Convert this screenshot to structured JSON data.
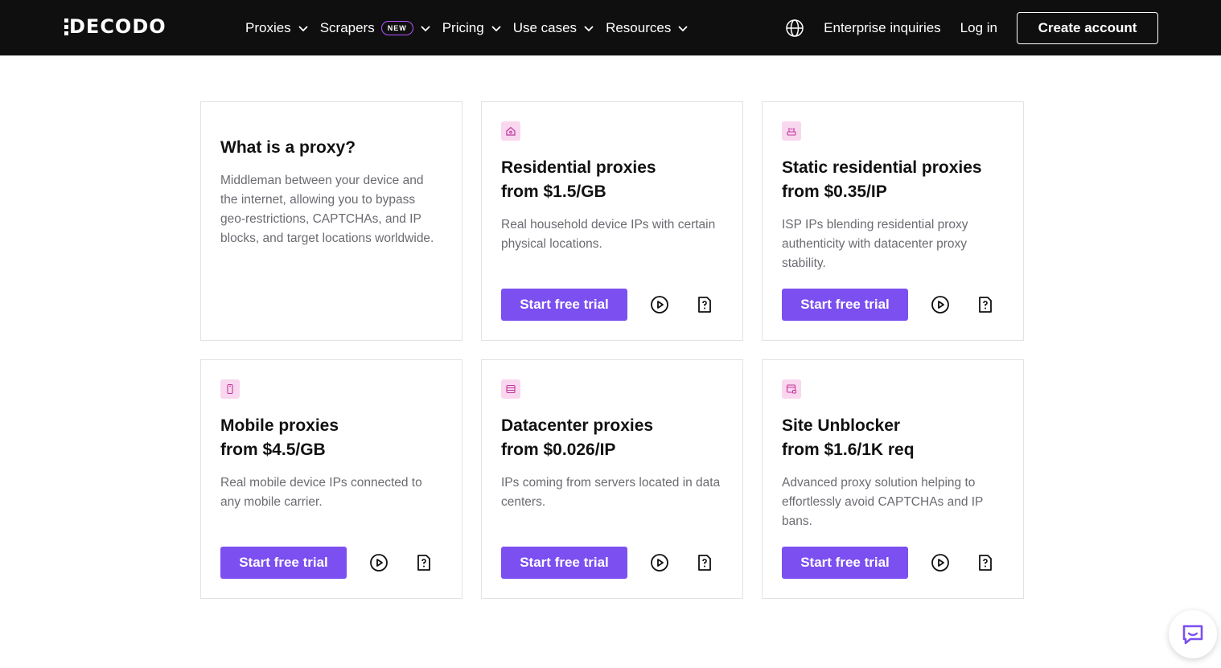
{
  "brand": {
    "logo_text": "DECODO"
  },
  "nav": {
    "items": [
      {
        "label": "Proxies",
        "badge": ""
      },
      {
        "label": "Scrapers",
        "badge": "NEW"
      },
      {
        "label": "Pricing",
        "badge": ""
      },
      {
        "label": "Use cases",
        "badge": ""
      },
      {
        "label": "Resources",
        "badge": ""
      }
    ],
    "enterprise": "Enterprise inquiries",
    "login": "Log in",
    "create_account": "Create account"
  },
  "intro_card": {
    "title": "What is a proxy?",
    "description": "Middleman between your device and the internet, allowing you to bypass geo-restrictions, CAPTCHAs, and IP blocks, and target locations worldwide."
  },
  "products": [
    {
      "icon": "home-icon",
      "title": "Residential proxies",
      "price": "from $1.5/GB",
      "description": "Real household device IPs with certain physical locations.",
      "cta": "Start free trial"
    },
    {
      "icon": "router-icon",
      "title": "Static residential proxies",
      "price": "from $0.35/IP",
      "description": "ISP IPs blending residential proxy authenticity with datacenter proxy stability.",
      "cta": "Start free trial"
    },
    {
      "icon": "mobile-icon",
      "title": "Mobile proxies",
      "price": "from $4.5/GB",
      "description": "Real mobile device IPs connected to any mobile carrier.",
      "cta": "Start free trial"
    },
    {
      "icon": "server-icon",
      "title": "Datacenter proxies",
      "price": "from $0.026/IP",
      "description": "IPs coming from servers located in data centers.",
      "cta": "Start free trial"
    },
    {
      "icon": "browser-lock-icon",
      "title": "Site Unblocker",
      "price": "from $1.6/1K req",
      "description": "Advanced proxy solution helping to effortlessly avoid CAPTCHAs and IP bans.",
      "cta": "Start free trial"
    }
  ],
  "colors": {
    "topbar": "#0f0f10",
    "accent": "#7b4ff0",
    "icon_bg": "#f9d7ef",
    "icon_stroke": "#c2369b"
  }
}
